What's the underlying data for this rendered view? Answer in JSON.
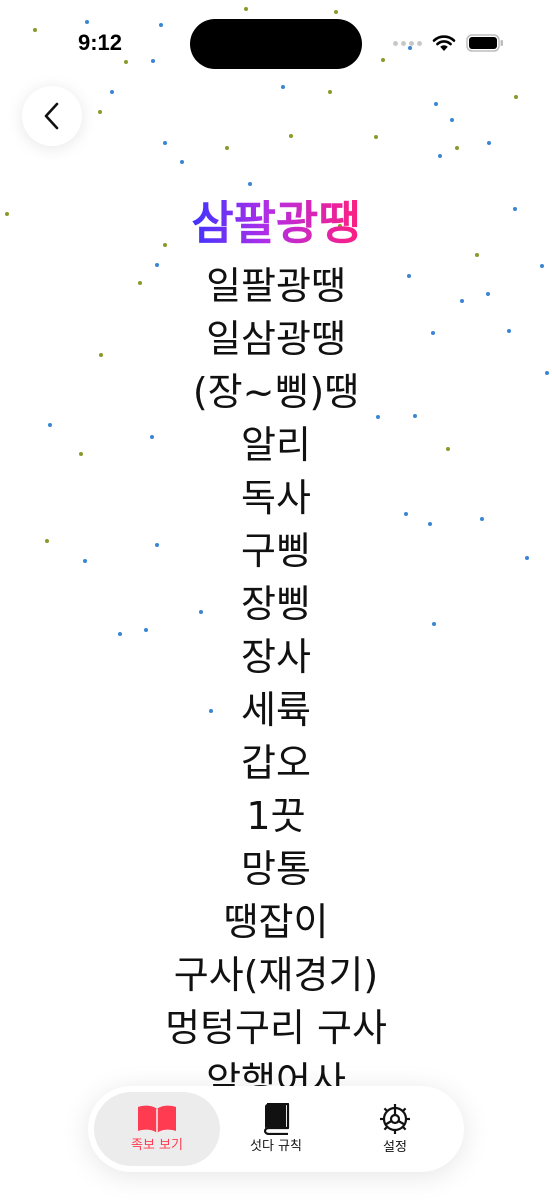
{
  "status_bar": {
    "time": "9:12"
  },
  "header": {
    "back_icon": "chevron-left-icon"
  },
  "title": "삼팔광땡",
  "ranks": [
    "일팔광땡",
    "일삼광땡",
    "(장~삥)땡",
    "알리",
    "독사",
    "구삥",
    "장삥",
    "장사",
    "세륙",
    "갑오",
    "1끗",
    "망통",
    "땡잡이",
    "구사(재경기)",
    "멍텅구리 구사",
    "암행어사"
  ],
  "tab_bar": {
    "tabs": [
      {
        "label": "족보 보기",
        "icon": "open-book-icon",
        "selected": true
      },
      {
        "label": "섯다 규칙",
        "icon": "closed-book-icon",
        "selected": false
      },
      {
        "label": "설정",
        "icon": "gear-icon",
        "selected": false
      }
    ]
  },
  "colors": {
    "accent": "#ff3b52",
    "title_gradient": [
      "#3d34ff",
      "#b22ee6",
      "#ff1e7e"
    ],
    "confetti": [
      "#3a86d4",
      "#8a9a2a"
    ]
  }
}
